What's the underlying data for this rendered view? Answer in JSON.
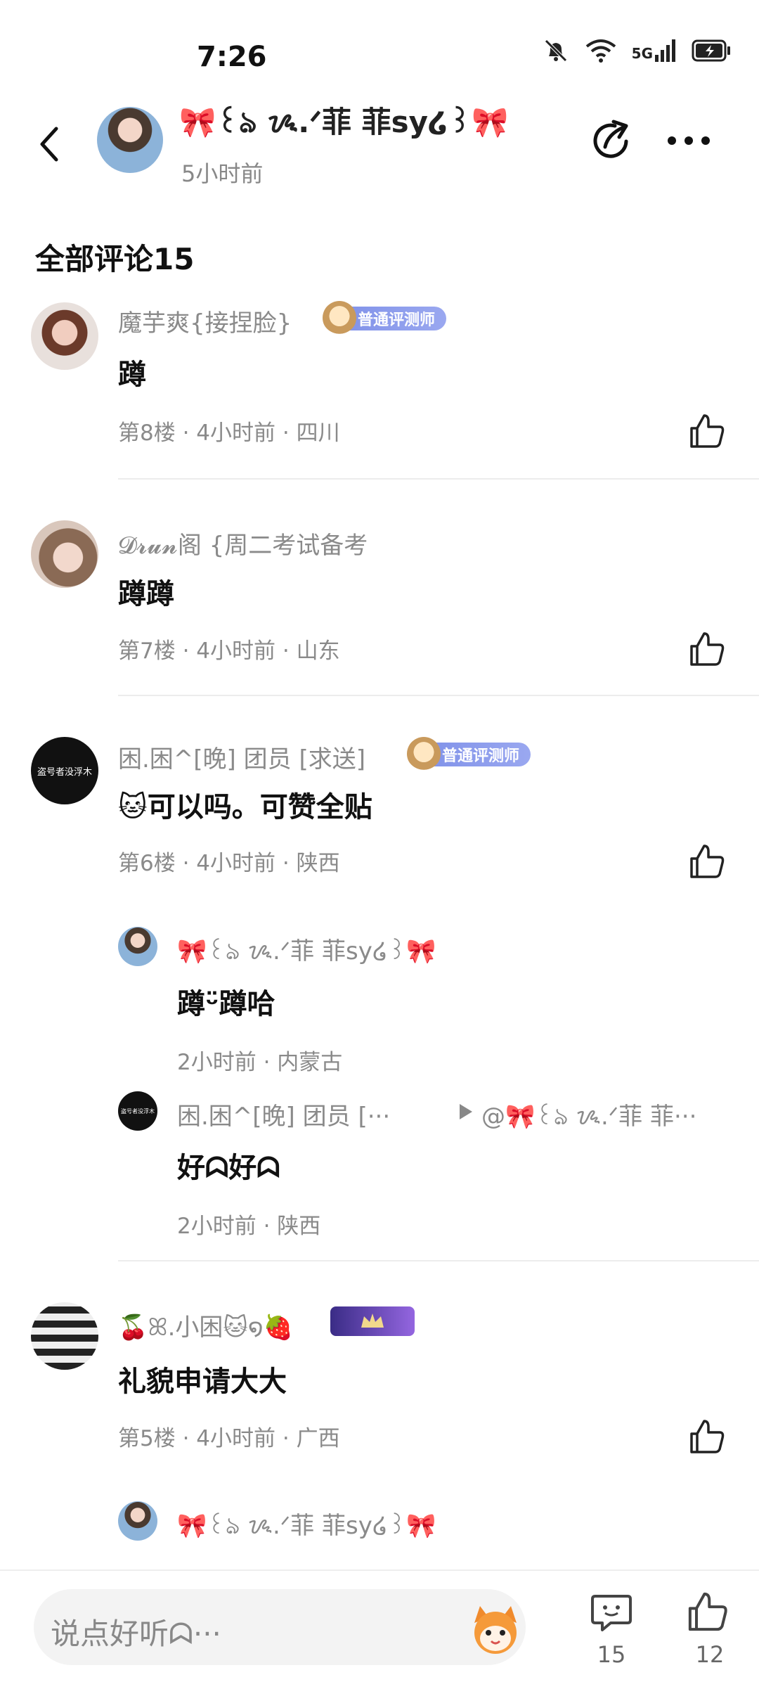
{
  "status_bar": {
    "time": "7:26",
    "network": "5G"
  },
  "header": {
    "author": "🎀꒰ঌ ᝰ.ᐟ菲 菲sy໒꒱🎀",
    "time_ago": "5小时前"
  },
  "section_title": "全部评论15",
  "comments": [
    {
      "user": "魔芋爽{接捏脸}",
      "badge": "普通评测师",
      "text": "蹲",
      "meta": "第8楼 · 4小时前 · 四川"
    },
    {
      "user": "𝓓𝓻𝓾𝓷阁 {周二考试备考",
      "text": "蹲蹲",
      "meta": "第7楼 · 4小时前 · 山东"
    },
    {
      "user": "困.困^[晚] 团员 [求送]",
      "badge": "普通评测师",
      "avatar_text": "盗号者没浮木",
      "text": "🐱可以吗。可赞全贴",
      "meta": "第6楼 · 4小时前 · 陕西",
      "replies": [
        {
          "user": "🎀꒰ঌ ᝰ.ᐟ菲 菲sy໒꒱🎀",
          "text": "蹲ᵕ̈蹲哈",
          "meta": "2小时前 · 内蒙古"
        },
        {
          "user": "困.困^[晚] 团员 [···",
          "avatar_text": "盗号者没浮木",
          "reply_to": "@🎀꒰ঌ ᝰ.ᐟ菲 菲···",
          "text": "好ᗣ好ᗣ",
          "meta": "2小时前 · 陕西"
        }
      ]
    },
    {
      "user": "🍒ꕤ.小困🐱໑🍓",
      "text": "礼貌申请大大",
      "meta": "第5楼 · 4小时前 · 广西",
      "replies": [
        {
          "user": "🎀꒰ঌ ᝰ.ᐟ菲 菲sy໒꒱🎀"
        }
      ]
    }
  ],
  "bottom_bar": {
    "placeholder": "说点好听ᗣ···",
    "comment_count": "15",
    "like_count": "12"
  }
}
